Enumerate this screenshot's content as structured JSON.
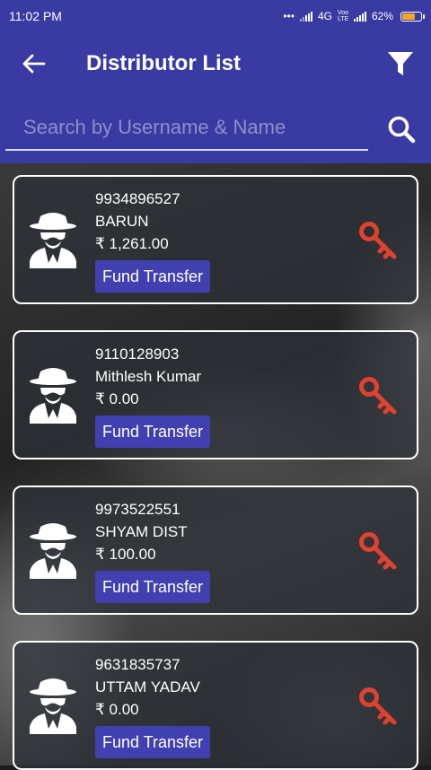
{
  "status_bar": {
    "time": "11:02 PM",
    "network": "4G",
    "volte": "Voo LTE",
    "battery": "62%"
  },
  "app_bar": {
    "title": "Distributor List",
    "back_icon": "arrow-left-icon",
    "filter_icon": "filter-icon"
  },
  "search": {
    "placeholder": "Search by Username & Name",
    "value": "",
    "icon": "search-icon"
  },
  "colors": {
    "primary": "#3a3aa3",
    "button": "#4040b0",
    "key": "#e0422f",
    "card_border": "#ffffff"
  },
  "distributors": [
    {
      "phone": "9934896527",
      "name": "BARUN",
      "balance": "₹ 1,261.00",
      "action": "Fund Transfer"
    },
    {
      "phone": "9110128903",
      "name": "Mithlesh Kumar",
      "balance": "₹ 0.00",
      "action": "Fund Transfer"
    },
    {
      "phone": "9973522551",
      "name": "SHYAM DIST",
      "balance": "₹ 100.00",
      "action": "Fund Transfer"
    },
    {
      "phone": "9631835737",
      "name": "UTTAM YADAV",
      "balance": "₹ 0.00",
      "action": "Fund Transfer"
    }
  ]
}
